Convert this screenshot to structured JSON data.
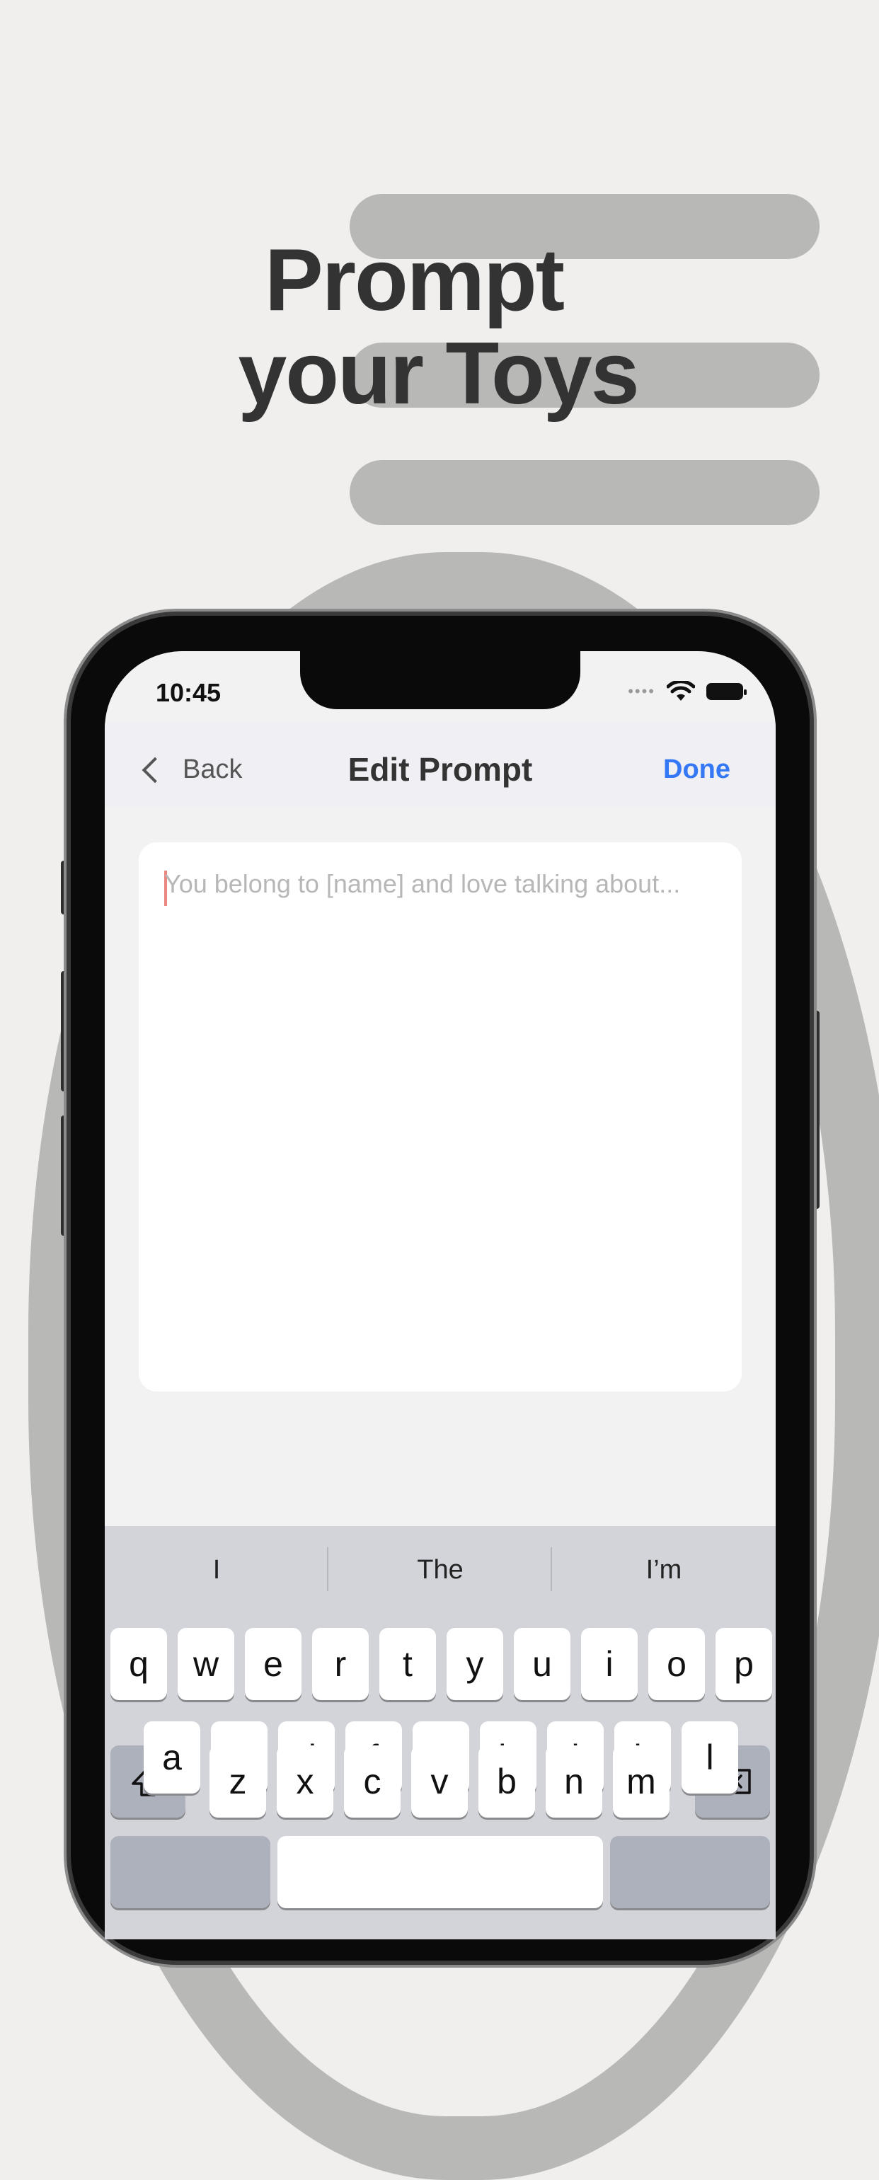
{
  "promo": {
    "headline_line1": "Prompt",
    "headline_line2": "your Toys"
  },
  "status_bar": {
    "time": "10:45",
    "signal_icon": "signal-dots-icon",
    "wifi_icon": "wifi-icon",
    "battery_icon": "battery-icon"
  },
  "nav": {
    "back_label": "Back",
    "title": "Edit Prompt",
    "done_label": "Done",
    "accent_color": "#3478f6"
  },
  "editor": {
    "value": "",
    "placeholder": "You belong to [name] and love talking about..."
  },
  "keyboard": {
    "suggestions": [
      "I",
      "The",
      "I’m"
    ],
    "row1": [
      "q",
      "w",
      "e",
      "r",
      "t",
      "y",
      "u",
      "i",
      "o",
      "p"
    ],
    "row2": [
      "a",
      "s",
      "d",
      "f",
      "g",
      "h",
      "j",
      "k",
      "l"
    ],
    "row3": [
      "z",
      "x",
      "c",
      "v",
      "b",
      "n",
      "m"
    ],
    "shift_icon": "shift-icon",
    "delete_icon": "backspace-icon"
  }
}
